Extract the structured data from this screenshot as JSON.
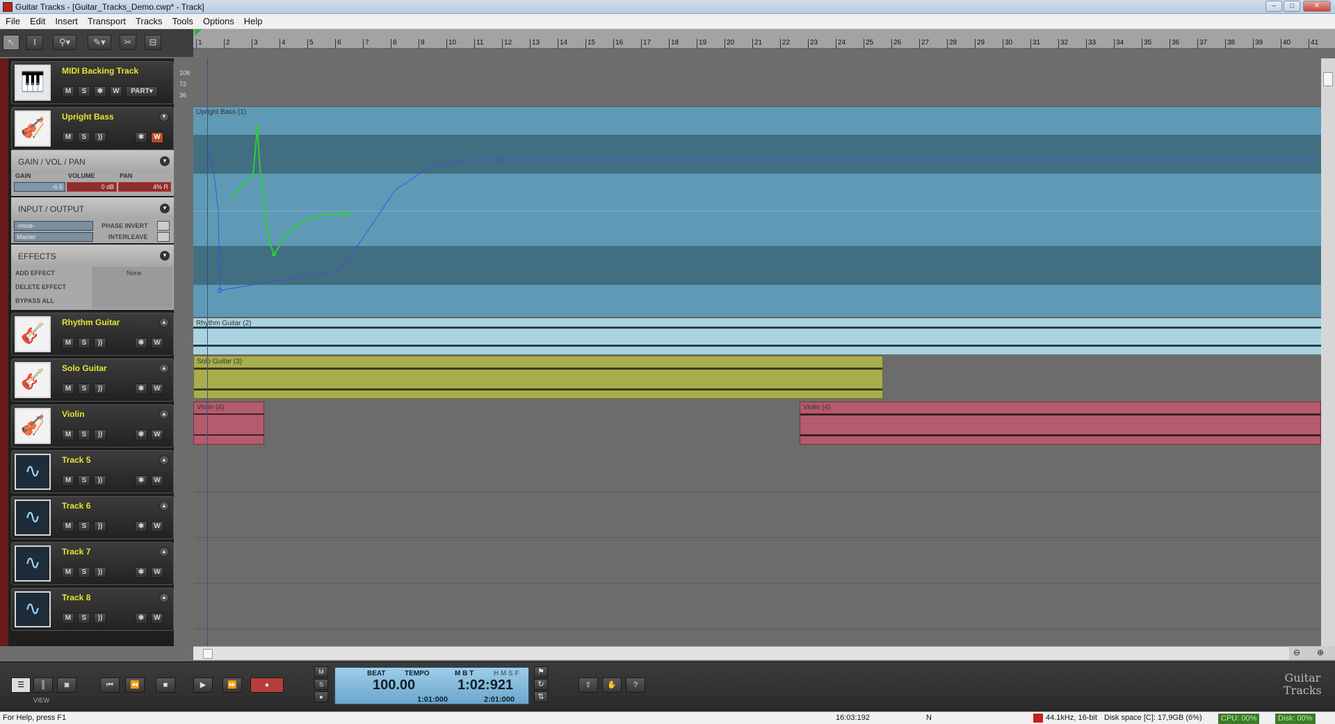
{
  "window": {
    "title": "Guitar Tracks - [Guitar_Tracks_Demo.cwp* - Track]",
    "controls": [
      "–",
      "□",
      "✕"
    ]
  },
  "menu": [
    "File",
    "Edit",
    "Insert",
    "Transport",
    "Tracks",
    "Tools",
    "Options",
    "Help"
  ],
  "toolbar": {
    "tools": [
      "select-tool-icon",
      "text-tool-icon",
      "zoom-tool-icon",
      "draw-tool-icon",
      "scissors-icon",
      "snap-icon"
    ]
  },
  "ruler": {
    "bars": [
      "1",
      "2",
      "3",
      "4",
      "5",
      "6",
      "7",
      "8",
      "9",
      "10",
      "11",
      "12",
      "13",
      "14",
      "15",
      "16",
      "17",
      "18",
      "19",
      "20",
      "21",
      "22",
      "23",
      "24",
      "25",
      "26",
      "27",
      "28",
      "29",
      "30",
      "31",
      "32",
      "33",
      "34",
      "35",
      "36",
      "37",
      "38",
      "39",
      "40",
      "41"
    ]
  },
  "tracks": [
    {
      "name": "MIDI Backing Track",
      "icon": "piano-icon",
      "buttons": [
        "M",
        "S",
        "✱",
        "W"
      ],
      "extra": "PART▾"
    },
    {
      "name": "Upright Bass",
      "icon": "violin-icon",
      "buttons": [
        "M",
        "S",
        "))",
        "✱",
        "W"
      ]
    },
    {
      "name": "Rhythm Guitar",
      "icon": "electric-guitar-icon",
      "buttons": [
        "M",
        "S",
        "))",
        "✱",
        "W"
      ]
    },
    {
      "name": "Solo Guitar",
      "icon": "acoustic-guitar-icon",
      "buttons": [
        "M",
        "S",
        "))",
        "✱",
        "W"
      ]
    },
    {
      "name": "Violin",
      "icon": "violin-icon",
      "buttons": [
        "M",
        "S",
        "))",
        "✱",
        "W"
      ]
    },
    {
      "name": "Track 5",
      "icon": "waveform-icon",
      "buttons": [
        "M",
        "S",
        "))",
        "✱",
        "W"
      ]
    },
    {
      "name": "Track 6",
      "icon": "waveform-icon",
      "buttons": [
        "M",
        "S",
        "))",
        "✱",
        "W"
      ]
    },
    {
      "name": "Track 7",
      "icon": "waveform-icon",
      "buttons": [
        "M",
        "S",
        "))",
        "✱",
        "W"
      ]
    },
    {
      "name": "Track 8",
      "icon": "waveform-icon",
      "buttons": [
        "M",
        "S",
        "))",
        "✱",
        "W"
      ]
    }
  ],
  "inspector": {
    "gain_section": "GAIN / VOL / PAN",
    "gain_label": "GAIN",
    "volume_label": "VOLUME",
    "pan_label": "PAN",
    "gain_value": "-6.5",
    "volume_value": "0 dB",
    "pan_value": "4% R",
    "io_section": "INPUT / OUTPUT",
    "input_value": "-none-",
    "output_value": "Master",
    "phase_invert": "PHASE INVERT",
    "interleave": "INTERLEAVE",
    "effects_section": "EFFECTS",
    "add_effect": "ADD EFFECT",
    "delete_effect": "DELETE EFFECT",
    "bypass_all": "BYPASS ALL",
    "effect_none": "None"
  },
  "midi_scale": [
    "108",
    "72",
    "36"
  ],
  "clips": {
    "upright_bass": "Upright Bass (1)",
    "rhythm_guitar": "Rhythm Guitar (2)",
    "solo_guitar": "Solo Guitar (3)",
    "violin_a": "Violin (4)",
    "violin_b": "Violin (4)"
  },
  "transport": {
    "view_label": "VIEW",
    "beat_label": "BEAT",
    "tempo_label": "TEMPO",
    "tempo_value": "100.00",
    "mbt_label": "M B T",
    "hmsf_label": "H M S F",
    "time_value": "1:02:921",
    "loop_start": "1:01:000",
    "loop_end": "2:01:000",
    "mixer_buttons": [
      "M",
      "S",
      "●"
    ],
    "logo_line1": "Guitar",
    "logo_line2": "Tracks"
  },
  "status": {
    "help": "For Help, press F1",
    "time": "16:03:192",
    "mode": "N",
    "format": "44.1kHz, 16-bit",
    "disk_space": "Disk space [C]: 17,9GB (6%)",
    "cpu": "CPU: 00%",
    "disk": "Disk: 00%"
  },
  "colors": {
    "bass_clip": "#5e9ab5",
    "rhythm_clip": "#a9d3e0",
    "solo_clip": "#a9ad4e",
    "violin_clip": "#b45b6e",
    "track_name": "#e5e531"
  }
}
